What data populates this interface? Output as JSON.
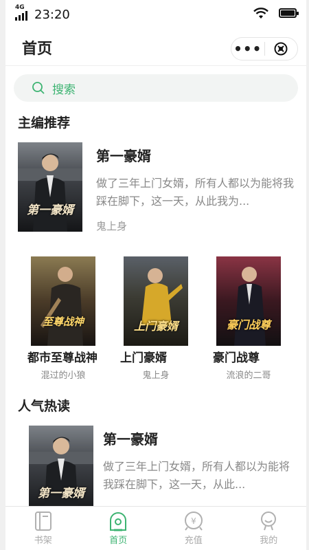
{
  "status_bar": {
    "network": "4G",
    "time": "23:20"
  },
  "header": {
    "title": "首页"
  },
  "search": {
    "placeholder": "搜索"
  },
  "editor_pick": {
    "title": "主编推荐",
    "featured": {
      "name": "第一豪婿",
      "desc": "做了三年上门女婿，所有人都以为能将我踩在脚下，这一天，从此我为...",
      "author": "鬼上身",
      "cover_title": "第一豪婿"
    },
    "grid": [
      {
        "name": "都市至尊战神",
        "author": "混过的小狼",
        "cover_title": "至尊战神",
        "cover_colors": [
          "#6b5a3a",
          "#2a2420"
        ]
      },
      {
        "name": "上门豪婿",
        "author": "鬼上身",
        "cover_title": "上门豪婿",
        "cover_colors": [
          "#3a4048",
          "#b89a2a"
        ]
      },
      {
        "name": "豪门战尊",
        "author": "流浪的二哥",
        "cover_title": "豪门战尊",
        "cover_colors": [
          "#7a2a3a",
          "#1a1418"
        ]
      }
    ]
  },
  "popular": {
    "title": "人气热读",
    "featured": {
      "name": "第一豪婿",
      "desc": "做了三年上门女婿，所有人都以为能将我踩在脚下，这一天，从此...",
      "cover_title": "第一豪婿"
    }
  },
  "tabbar": {
    "items": [
      {
        "label": "书架",
        "icon": "bookshelf-icon"
      },
      {
        "label": "首页",
        "icon": "home-icon"
      },
      {
        "label": "充值",
        "icon": "recharge-icon"
      },
      {
        "label": "我的",
        "icon": "profile-icon"
      }
    ],
    "active_index": 1,
    "accent_color": "#3cb371",
    "inactive_color": "#aaaaaa"
  }
}
